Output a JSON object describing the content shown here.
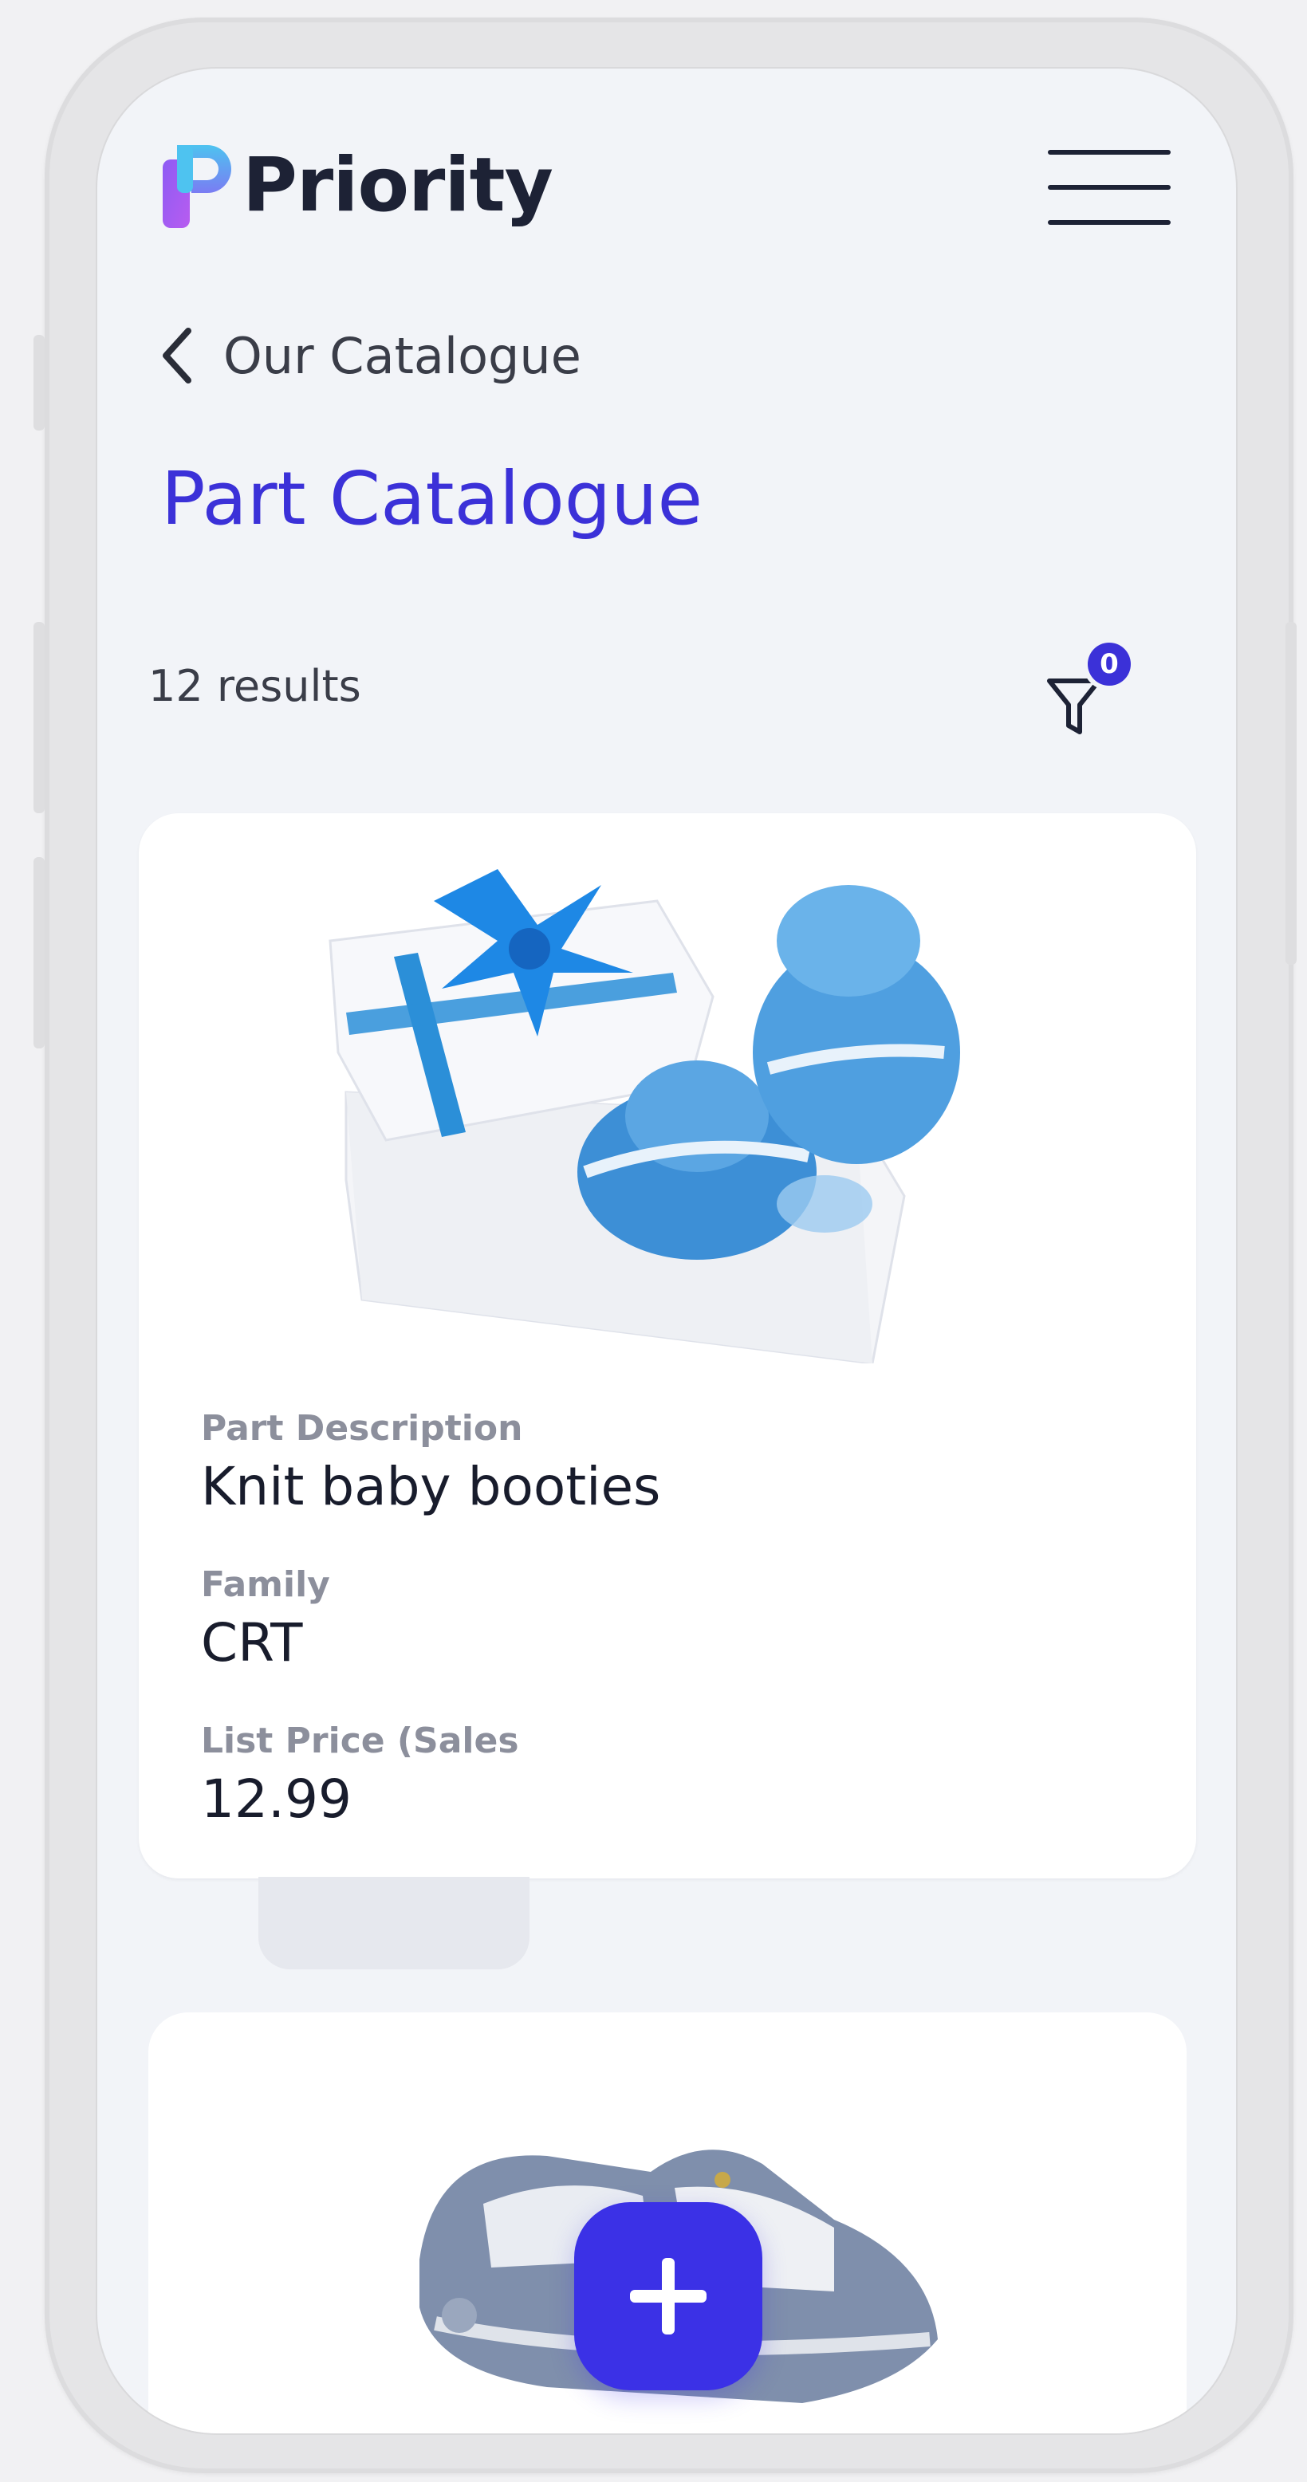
{
  "app": {
    "brand_name": "Priority",
    "brand_colors": {
      "primary": "#3b31d8",
      "logo_cyan": "#4ec3f0",
      "logo_violet": "#a35cf0"
    }
  },
  "header": {
    "menu_icon": "hamburger-icon"
  },
  "breadcrumb": {
    "back_icon": "chevron-left-icon",
    "label": "Our Catalogue"
  },
  "page": {
    "title": "Part Catalogue",
    "results_text": "12 results"
  },
  "filter": {
    "icon": "filter-icon",
    "badge_count": "0"
  },
  "cards": [
    {
      "image_icon": "product-image-baby-booties",
      "fields": [
        {
          "label": "Part Description",
          "value": "Knit baby booties"
        },
        {
          "label": "Family",
          "value": "CRT"
        },
        {
          "label": "List Price (Sales",
          "value": "12.99"
        }
      ]
    },
    {
      "image_icon": "product-image-sandal"
    }
  ],
  "fab": {
    "icon": "plus-icon"
  }
}
